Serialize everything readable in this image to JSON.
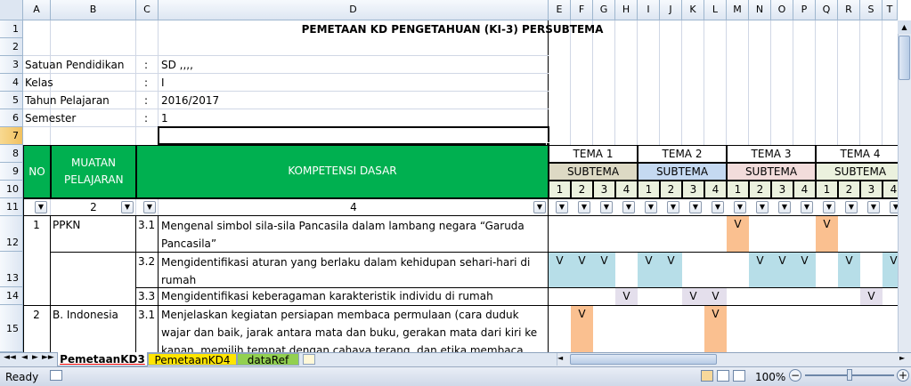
{
  "columns": [
    "A",
    "B",
    "C",
    "D",
    "E",
    "F",
    "G",
    "H",
    "I",
    "J",
    "K",
    "L",
    "M",
    "N",
    "O",
    "P",
    "Q",
    "R",
    "S",
    "T"
  ],
  "rows": [
    "1",
    "2",
    "3",
    "4",
    "5",
    "6",
    "7",
    "8",
    "9",
    "10",
    "11",
    "12",
    "13",
    "14",
    "15"
  ],
  "title": "PEMETAAN KD PENGETAHUAN (KI-3) PERSUBTEMA",
  "info": [
    {
      "label": "Satuan Pendidikan",
      "sep": ":",
      "value": "SD ,,,,"
    },
    {
      "label": "Kelas",
      "sep": ":",
      "value": "I"
    },
    {
      "label": "Tahun Pelajaran",
      "sep": ":",
      "value": "2016/2017"
    },
    {
      "label": "Semester",
      "sep": ":",
      "value": "1"
    }
  ],
  "header": {
    "no": "NO",
    "muatan": "MUATAN PELAJARAN",
    "kd": "KOMPETENSI DASAR",
    "temas": [
      "TEMA 1",
      "TEMA 2",
      "TEMA 3",
      "TEMA 4"
    ],
    "subtema": "SUBTEMA",
    "sub_numbers": [
      "1",
      "2",
      "3",
      "4"
    ],
    "filter_nums": {
      "b": "2",
      "d": "4"
    }
  },
  "body": [
    {
      "no": "1",
      "muatan": "PPKN",
      "kd_no": "3.1",
      "kd": "Mengenal simbol sila-sila Pancasila dalam lambang negara “Garuda Pancasila”"
    },
    {
      "no": "",
      "muatan": "",
      "kd_no": "3.2",
      "kd": "Mengidentifikasi aturan yang berlaku dalam kehidupan sehari-hari di rumah"
    },
    {
      "no": "",
      "muatan": "",
      "kd_no": "3.3",
      "kd": "Mengidentifikasi keberagaman karakteristik individu di rumah"
    },
    {
      "no": "2",
      "muatan": "B. Indonesia",
      "kd_no": "3.1",
      "kd": "Menjelaskan kegiatan persiapan membaca permulaan (cara duduk wajar dan baik, jarak antara mata dan buku, gerakan mata dari kiri ke kanan, memilih tempat dengan cahaya terang, dan etika membaca"
    }
  ],
  "mark": "V",
  "sheets": [
    "PemetaanKD3",
    "PemetaanKD4",
    "dataRef"
  ],
  "status": {
    "ready": "Ready",
    "zoom": "100%"
  },
  "colors": {
    "green": "#00b050",
    "orange": "#fac090",
    "blue": "#b7dee8",
    "purple": "#e4dfec"
  }
}
